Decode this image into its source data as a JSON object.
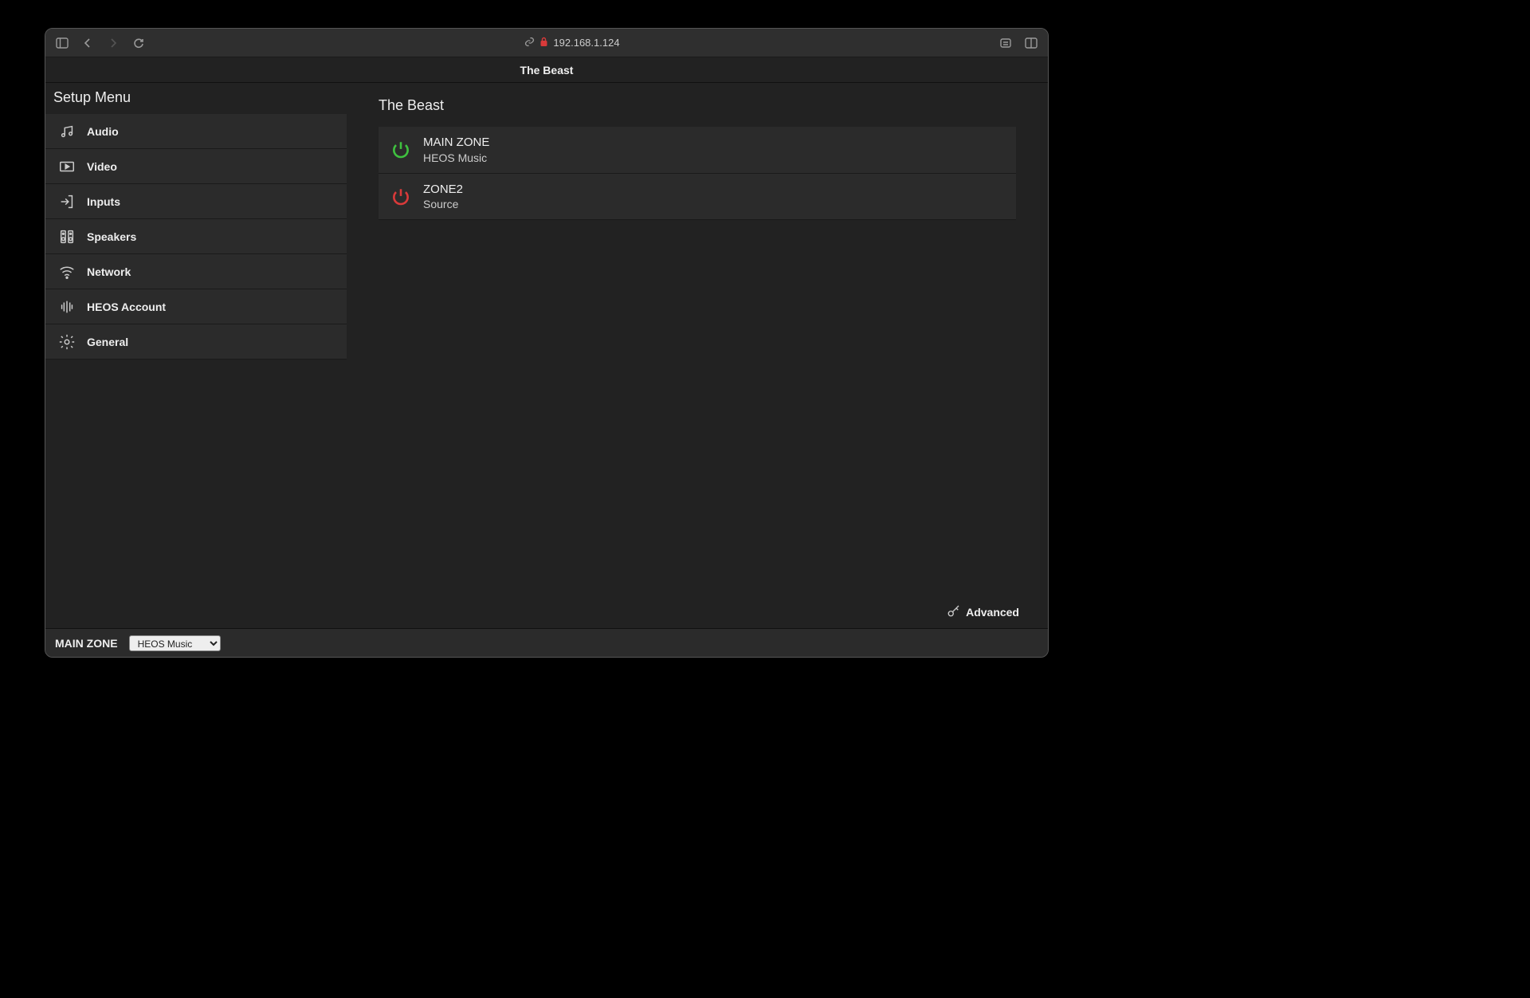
{
  "browser": {
    "address": "192.168.1.124"
  },
  "page_title": "The Beast",
  "sidebar": {
    "title": "Setup Menu",
    "items": [
      {
        "label": "Audio"
      },
      {
        "label": "Video"
      },
      {
        "label": "Inputs"
      },
      {
        "label": "Speakers"
      },
      {
        "label": "Network"
      },
      {
        "label": "HEOS Account"
      },
      {
        "label": "General"
      }
    ]
  },
  "main": {
    "device_name": "The Beast",
    "zones": [
      {
        "name": "MAIN ZONE",
        "source": "HEOS Music",
        "power": "on"
      },
      {
        "name": "ZONE2",
        "source": "Source",
        "power": "off"
      }
    ],
    "advanced_label": "Advanced"
  },
  "footer": {
    "zone_label": "MAIN ZONE",
    "source_selected": "HEOS Music"
  }
}
